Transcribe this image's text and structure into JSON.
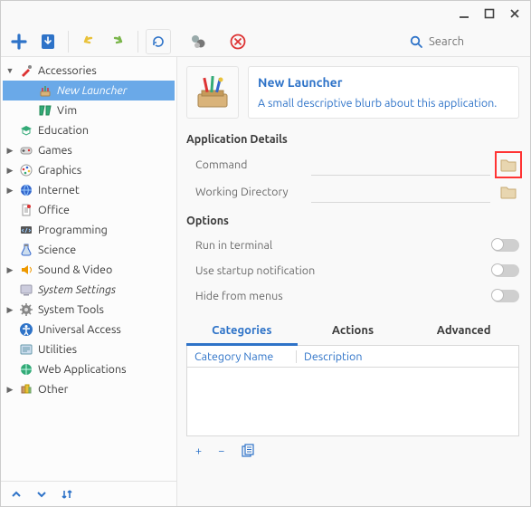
{
  "window": {
    "minimize": "_",
    "maximize": "□",
    "close": "✕"
  },
  "toolbar": {
    "search_placeholder": "Search"
  },
  "sidebar": {
    "items": [
      {
        "label": "Accessories",
        "expanded": true,
        "children": [
          {
            "label": "New Launcher",
            "selected": true
          },
          {
            "label": "Vim"
          }
        ]
      },
      {
        "label": "Education"
      },
      {
        "label": "Games",
        "expandable": true
      },
      {
        "label": "Graphics",
        "expandable": true
      },
      {
        "label": "Internet",
        "expandable": true
      },
      {
        "label": "Office"
      },
      {
        "label": "Programming"
      },
      {
        "label": "Science"
      },
      {
        "label": "Sound & Video",
        "expandable": true
      },
      {
        "label": "System Settings",
        "italic": true
      },
      {
        "label": "System Tools",
        "expandable": true
      },
      {
        "label": "Universal Access"
      },
      {
        "label": "Utilities"
      },
      {
        "label": "Web Applications"
      },
      {
        "label": "Other",
        "expandable": true
      }
    ]
  },
  "main": {
    "title": "New Launcher",
    "description": "A small descriptive blurb about this application.",
    "details_heading": "Application Details",
    "fields": {
      "command_label": "Command",
      "workdir_label": "Working Directory"
    },
    "options_heading": "Options",
    "options": {
      "run_in_terminal": "Run in terminal",
      "startup_notification": "Use startup notification",
      "hide_from_menus": "Hide from menus"
    },
    "tabs": {
      "categories": "Categories",
      "actions": "Actions",
      "advanced": "Advanced"
    },
    "table": {
      "col_name": "Category Name",
      "col_desc": "Description"
    },
    "row_actions": {
      "add": "+",
      "remove": "−",
      "clear": "⧉"
    }
  }
}
